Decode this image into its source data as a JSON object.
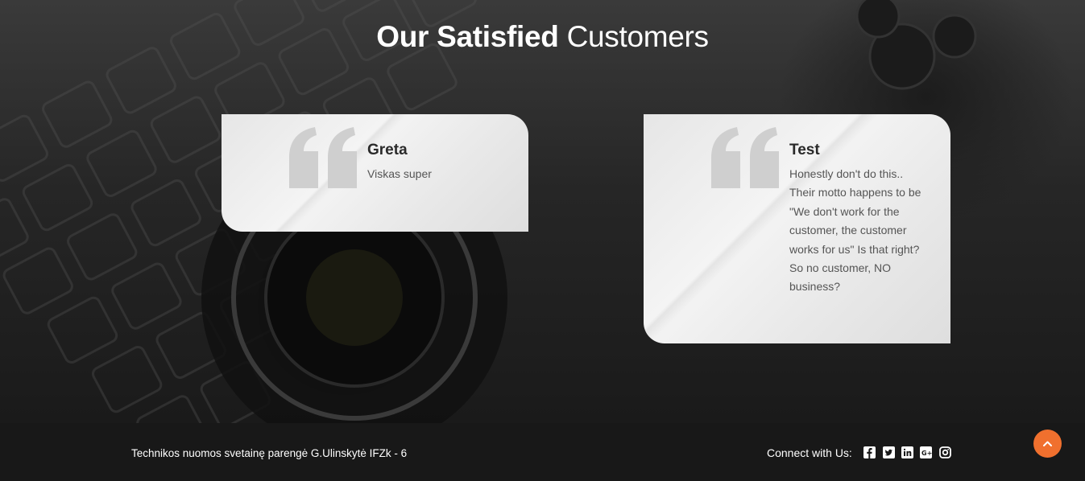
{
  "section": {
    "title_bold": "Our Satisfied",
    "title_light": "Customers"
  },
  "testimonials": [
    {
      "name": "Greta",
      "text": "Viskas super"
    },
    {
      "name": "Test",
      "text": "Honestly don't do this.. Their motto happens to be \"We don't work for the customer, the customer works for us\" Is that right? So no customer, NO business?"
    }
  ],
  "footer": {
    "credit": "Technikos nuomos svetainę parengė G.Ulinskytė IFZk - 6",
    "connect_label": "Connect with Us:",
    "social_icons": [
      "facebook-icon",
      "twitter-icon",
      "linkedin-icon",
      "google-plus-icon",
      "instagram-icon"
    ]
  },
  "colors": {
    "accent": "#f0702e",
    "footer_bg": "#181818",
    "card_bg": "#eeeeee"
  },
  "icons": {
    "scroll_top": "chevron-up-icon",
    "quote": "quote-icon"
  }
}
